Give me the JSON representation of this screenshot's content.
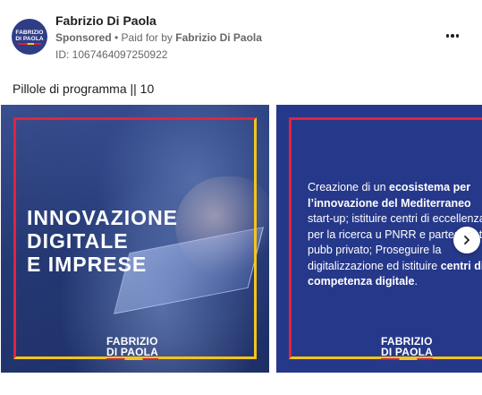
{
  "header": {
    "avatar": {
      "line1": "FABRIZIO",
      "line2": "DI PAOLA",
      "icon": "page-logo"
    },
    "page_name": "Fabrizio Di Paola",
    "sponsored_label": "Sponsored",
    "separator": " • ",
    "paid_for_prefix": "Paid for by ",
    "paid_for_name": "Fabrizio Di Paola",
    "ad_id": "ID: 1067464097250922",
    "more_icon": "more-horizontal-icon"
  },
  "post": {
    "body_text": "Pillole di programma || 10"
  },
  "carousel": {
    "slides": [
      {
        "headline": "INNOVAZIONE\nDIGITALE\nE IMPRESE",
        "brand_line1": "FABRIZIO",
        "brand_line2": "DI PAOLA"
      },
      {
        "text_parts": [
          {
            "t": "Creazione di un ",
            "bold": false
          },
          {
            "t": "ecosistema per l’innovazione del Mediterraneo",
            "bold": true
          },
          {
            "t": " start-up; istituire centri di eccellenza per la ricerca u PNRR e partenariato pubb privato; Proseguire la digitalizzazione ed istituire ",
            "bold": false
          },
          {
            "t": "centri di competenza digitale",
            "bold": true
          },
          {
            "t": ".",
            "bold": false
          }
        ],
        "brand_line1": "FABRIZIO",
        "brand_line2": "DI PAOLA"
      }
    ],
    "next_icon": "chevron-right-icon"
  },
  "colors": {
    "brand_blue": "#26388a",
    "accent_red": "#e2233d",
    "accent_yellow": "#f4c419",
    "text_primary": "#1c1e21",
    "text_secondary": "#65676b"
  }
}
